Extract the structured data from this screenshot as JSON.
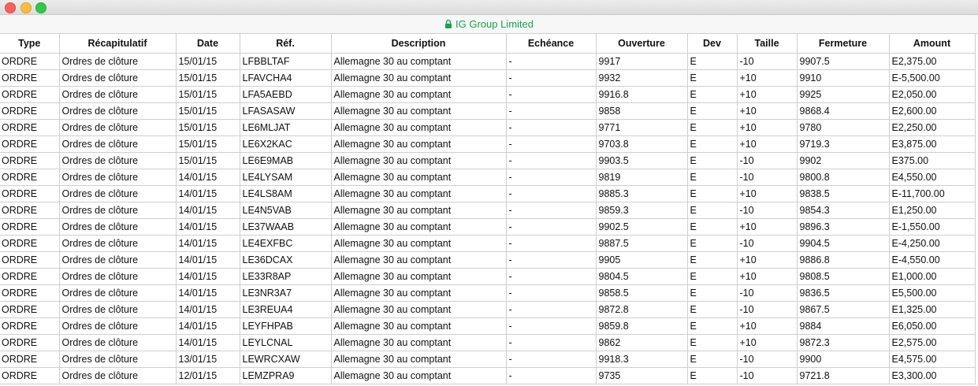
{
  "window": {
    "site_label": "IG Group Limited"
  },
  "table": {
    "headers": [
      "Type",
      "Récapitulatif",
      "Date",
      "Réf.",
      "Description",
      "Echéance",
      "Ouverture",
      "Dev",
      "Taille",
      "Fermeture",
      "Amount"
    ],
    "rows": [
      [
        "ORDRE",
        "Ordres de clôture",
        "15/01/15",
        "LFBBLTAF",
        "Allemagne 30 au comptant",
        "-",
        "9917",
        "E",
        "-10",
        "9907.5",
        "E2,375.00"
      ],
      [
        "ORDRE",
        "Ordres de clôture",
        "15/01/15",
        "LFAVCHA4",
        "Allemagne 30 au comptant",
        "-",
        "9932",
        "E",
        "+10",
        "9910",
        "E-5,500.00"
      ],
      [
        "ORDRE",
        "Ordres de clôture",
        "15/01/15",
        "LFA5AEBD",
        "Allemagne 30 au comptant",
        "-",
        "9916.8",
        "E",
        "+10",
        "9925",
        "E2,050.00"
      ],
      [
        "ORDRE",
        "Ordres de clôture",
        "15/01/15",
        "LFASASAW",
        "Allemagne 30 au comptant",
        "-",
        "9858",
        "E",
        "+10",
        "9868.4",
        "E2,600.00"
      ],
      [
        "ORDRE",
        "Ordres de clôture",
        "15/01/15",
        "LE6MLJAT",
        "Allemagne 30 au comptant",
        "-",
        "9771",
        "E",
        "+10",
        "9780",
        "E2,250.00"
      ],
      [
        "ORDRE",
        "Ordres de clôture",
        "15/01/15",
        "LE6X2KAC",
        "Allemagne 30 au comptant",
        "-",
        "9703.8",
        "E",
        "+10",
        "9719.3",
        "E3,875.00"
      ],
      [
        "ORDRE",
        "Ordres de clôture",
        "15/01/15",
        "LE6E9MAB",
        "Allemagne 30 au comptant",
        "-",
        "9903.5",
        "E",
        "-10",
        "9902",
        "E375.00"
      ],
      [
        "ORDRE",
        "Ordres de clôture",
        "14/01/15",
        "LE4LYSAM",
        "Allemagne 30 au comptant",
        "-",
        "9819",
        "E",
        "-10",
        "9800.8",
        "E4,550.00"
      ],
      [
        "ORDRE",
        "Ordres de clôture",
        "14/01/15",
        "LE4LS8AM",
        "Allemagne 30 au comptant",
        "-",
        "9885.3",
        "E",
        "+10",
        "9838.5",
        "E-11,700.00"
      ],
      [
        "ORDRE",
        "Ordres de clôture",
        "14/01/15",
        "LE4N5VAB",
        "Allemagne 30 au comptant",
        "-",
        "9859.3",
        "E",
        "-10",
        "9854.3",
        "E1,250.00"
      ],
      [
        "ORDRE",
        "Ordres de clôture",
        "14/01/15",
        "LE37WAAB",
        "Allemagne 30 au comptant",
        "-",
        "9902.5",
        "E",
        "+10",
        "9896.3",
        "E-1,550.00"
      ],
      [
        "ORDRE",
        "Ordres de clôture",
        "14/01/15",
        "LE4EXFBC",
        "Allemagne 30 au comptant",
        "-",
        "9887.5",
        "E",
        "-10",
        "9904.5",
        "E-4,250.00"
      ],
      [
        "ORDRE",
        "Ordres de clôture",
        "14/01/15",
        "LE36DCAX",
        "Allemagne 30 au comptant",
        "-",
        "9905",
        "E",
        "+10",
        "9886.8",
        "E-4,550.00"
      ],
      [
        "ORDRE",
        "Ordres de clôture",
        "14/01/15",
        "LE33R8AP",
        "Allemagne 30 au comptant",
        "-",
        "9804.5",
        "E",
        "+10",
        "9808.5",
        "E1,000.00"
      ],
      [
        "ORDRE",
        "Ordres de clôture",
        "14/01/15",
        "LE3NR3A7",
        "Allemagne 30 au comptant",
        "-",
        "9858.5",
        "E",
        "-10",
        "9836.5",
        "E5,500.00"
      ],
      [
        "ORDRE",
        "Ordres de clôture",
        "14/01/15",
        "LE3REUA4",
        "Allemagne 30 au comptant",
        "-",
        "9872.8",
        "E",
        "-10",
        "9867.5",
        "E1,325.00"
      ],
      [
        "ORDRE",
        "Ordres de clôture",
        "14/01/15",
        "LEYFHPAB",
        "Allemagne 30 au comptant",
        "-",
        "9859.8",
        "E",
        "+10",
        "9884",
        "E6,050.00"
      ],
      [
        "ORDRE",
        "Ordres de clôture",
        "14/01/15",
        "LEYLCNAL",
        "Allemagne 30 au comptant",
        "-",
        "9862",
        "E",
        "+10",
        "9872.3",
        "E2,575.00"
      ],
      [
        "ORDRE",
        "Ordres de clôture",
        "13/01/15",
        "LEWRCXAW",
        "Allemagne 30 au comptant",
        "-",
        "9918.3",
        "E",
        "-10",
        "9900",
        "E4,575.00"
      ],
      [
        "ORDRE",
        "Ordres de clôture",
        "12/01/15",
        "LEMZPRA9",
        "Allemagne 30 au comptant",
        "-",
        "9735",
        "E",
        "-10",
        "9721.8",
        "E3,300.00"
      ]
    ]
  },
  "colors": {
    "site_label": "#1aa34a"
  }
}
